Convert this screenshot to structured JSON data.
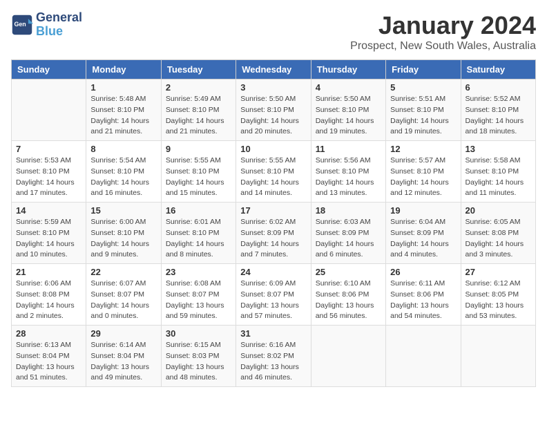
{
  "logo": {
    "line1": "General",
    "line2": "Blue"
  },
  "title": "January 2024",
  "subtitle": "Prospect, New South Wales, Australia",
  "weekdays": [
    "Sunday",
    "Monday",
    "Tuesday",
    "Wednesday",
    "Thursday",
    "Friday",
    "Saturday"
  ],
  "weeks": [
    [
      {
        "day": "",
        "info": ""
      },
      {
        "day": "1",
        "info": "Sunrise: 5:48 AM\nSunset: 8:10 PM\nDaylight: 14 hours\nand 21 minutes."
      },
      {
        "day": "2",
        "info": "Sunrise: 5:49 AM\nSunset: 8:10 PM\nDaylight: 14 hours\nand 21 minutes."
      },
      {
        "day": "3",
        "info": "Sunrise: 5:50 AM\nSunset: 8:10 PM\nDaylight: 14 hours\nand 20 minutes."
      },
      {
        "day": "4",
        "info": "Sunrise: 5:50 AM\nSunset: 8:10 PM\nDaylight: 14 hours\nand 19 minutes."
      },
      {
        "day": "5",
        "info": "Sunrise: 5:51 AM\nSunset: 8:10 PM\nDaylight: 14 hours\nand 19 minutes."
      },
      {
        "day": "6",
        "info": "Sunrise: 5:52 AM\nSunset: 8:10 PM\nDaylight: 14 hours\nand 18 minutes."
      }
    ],
    [
      {
        "day": "7",
        "info": "Sunrise: 5:53 AM\nSunset: 8:10 PM\nDaylight: 14 hours\nand 17 minutes."
      },
      {
        "day": "8",
        "info": "Sunrise: 5:54 AM\nSunset: 8:10 PM\nDaylight: 14 hours\nand 16 minutes."
      },
      {
        "day": "9",
        "info": "Sunrise: 5:55 AM\nSunset: 8:10 PM\nDaylight: 14 hours\nand 15 minutes."
      },
      {
        "day": "10",
        "info": "Sunrise: 5:55 AM\nSunset: 8:10 PM\nDaylight: 14 hours\nand 14 minutes."
      },
      {
        "day": "11",
        "info": "Sunrise: 5:56 AM\nSunset: 8:10 PM\nDaylight: 14 hours\nand 13 minutes."
      },
      {
        "day": "12",
        "info": "Sunrise: 5:57 AM\nSunset: 8:10 PM\nDaylight: 14 hours\nand 12 minutes."
      },
      {
        "day": "13",
        "info": "Sunrise: 5:58 AM\nSunset: 8:10 PM\nDaylight: 14 hours\nand 11 minutes."
      }
    ],
    [
      {
        "day": "14",
        "info": "Sunrise: 5:59 AM\nSunset: 8:10 PM\nDaylight: 14 hours\nand 10 minutes."
      },
      {
        "day": "15",
        "info": "Sunrise: 6:00 AM\nSunset: 8:10 PM\nDaylight: 14 hours\nand 9 minutes."
      },
      {
        "day": "16",
        "info": "Sunrise: 6:01 AM\nSunset: 8:10 PM\nDaylight: 14 hours\nand 8 minutes."
      },
      {
        "day": "17",
        "info": "Sunrise: 6:02 AM\nSunset: 8:09 PM\nDaylight: 14 hours\nand 7 minutes."
      },
      {
        "day": "18",
        "info": "Sunrise: 6:03 AM\nSunset: 8:09 PM\nDaylight: 14 hours\nand 6 minutes."
      },
      {
        "day": "19",
        "info": "Sunrise: 6:04 AM\nSunset: 8:09 PM\nDaylight: 14 hours\nand 4 minutes."
      },
      {
        "day": "20",
        "info": "Sunrise: 6:05 AM\nSunset: 8:08 PM\nDaylight: 14 hours\nand 3 minutes."
      }
    ],
    [
      {
        "day": "21",
        "info": "Sunrise: 6:06 AM\nSunset: 8:08 PM\nDaylight: 14 hours\nand 2 minutes."
      },
      {
        "day": "22",
        "info": "Sunrise: 6:07 AM\nSunset: 8:07 PM\nDaylight: 14 hours\nand 0 minutes."
      },
      {
        "day": "23",
        "info": "Sunrise: 6:08 AM\nSunset: 8:07 PM\nDaylight: 13 hours\nand 59 minutes."
      },
      {
        "day": "24",
        "info": "Sunrise: 6:09 AM\nSunset: 8:07 PM\nDaylight: 13 hours\nand 57 minutes."
      },
      {
        "day": "25",
        "info": "Sunrise: 6:10 AM\nSunset: 8:06 PM\nDaylight: 13 hours\nand 56 minutes."
      },
      {
        "day": "26",
        "info": "Sunrise: 6:11 AM\nSunset: 8:06 PM\nDaylight: 13 hours\nand 54 minutes."
      },
      {
        "day": "27",
        "info": "Sunrise: 6:12 AM\nSunset: 8:05 PM\nDaylight: 13 hours\nand 53 minutes."
      }
    ],
    [
      {
        "day": "28",
        "info": "Sunrise: 6:13 AM\nSunset: 8:04 PM\nDaylight: 13 hours\nand 51 minutes."
      },
      {
        "day": "29",
        "info": "Sunrise: 6:14 AM\nSunset: 8:04 PM\nDaylight: 13 hours\nand 49 minutes."
      },
      {
        "day": "30",
        "info": "Sunrise: 6:15 AM\nSunset: 8:03 PM\nDaylight: 13 hours\nand 48 minutes."
      },
      {
        "day": "31",
        "info": "Sunrise: 6:16 AM\nSunset: 8:02 PM\nDaylight: 13 hours\nand 46 minutes."
      },
      {
        "day": "",
        "info": ""
      },
      {
        "day": "",
        "info": ""
      },
      {
        "day": "",
        "info": ""
      }
    ]
  ]
}
